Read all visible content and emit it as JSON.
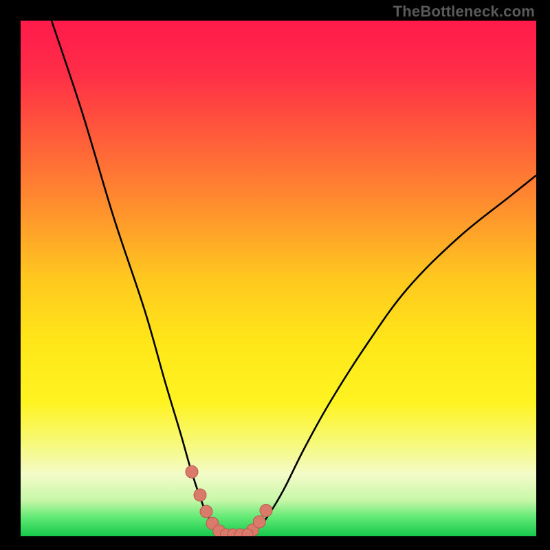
{
  "watermark": {
    "text": "TheBottleneck.com"
  },
  "colors": {
    "gradient_stops": [
      {
        "offset": 0.0,
        "color": "#ff1a4b"
      },
      {
        "offset": 0.1,
        "color": "#ff2d47"
      },
      {
        "offset": 0.22,
        "color": "#ff5a3a"
      },
      {
        "offset": 0.35,
        "color": "#ff8b2f"
      },
      {
        "offset": 0.5,
        "color": "#ffc81f"
      },
      {
        "offset": 0.62,
        "color": "#ffe619"
      },
      {
        "offset": 0.74,
        "color": "#fff321"
      },
      {
        "offset": 0.82,
        "color": "#f6f97a"
      },
      {
        "offset": 0.88,
        "color": "#f3fbc8"
      },
      {
        "offset": 0.93,
        "color": "#c8f7a8"
      },
      {
        "offset": 0.965,
        "color": "#5de872"
      },
      {
        "offset": 1.0,
        "color": "#15c84a"
      }
    ],
    "curve_stroke": "#000000",
    "marker_fill": "#d97a6b",
    "marker_stroke": "#b65a4f"
  },
  "chart_data": {
    "type": "line",
    "title": "",
    "xlabel": "",
    "ylabel": "",
    "xlim": [
      0,
      100
    ],
    "ylim": [
      0,
      100
    ],
    "grid": false,
    "left_curve": {
      "points": [
        [
          6,
          100
        ],
        [
          12,
          82
        ],
        [
          18,
          62
        ],
        [
          24,
          44
        ],
        [
          28,
          30
        ],
        [
          31,
          20
        ],
        [
          33,
          13
        ],
        [
          35,
          7
        ],
        [
          36.5,
          3.5
        ],
        [
          38,
          1.2
        ],
        [
          39.5,
          0.4
        ]
      ]
    },
    "right_curve": {
      "points": [
        [
          44,
          0.4
        ],
        [
          46,
          1.5
        ],
        [
          48,
          4
        ],
        [
          51,
          9
        ],
        [
          55,
          17
        ],
        [
          60,
          26
        ],
        [
          67,
          37
        ],
        [
          75,
          48
        ],
        [
          85,
          58
        ],
        [
          95,
          66
        ],
        [
          100,
          70
        ]
      ]
    },
    "flat_segment": {
      "x_start": 39.5,
      "x_end": 44,
      "y": 0.4
    },
    "markers_left": [
      {
        "x": 33.2,
        "y": 12.5
      },
      {
        "x": 34.8,
        "y": 8.0
      },
      {
        "x": 36.0,
        "y": 4.8
      },
      {
        "x": 37.2,
        "y": 2.5
      },
      {
        "x": 38.5,
        "y": 1.0
      }
    ],
    "markers_right": [
      {
        "x": 45.0,
        "y": 1.2
      },
      {
        "x": 46.3,
        "y": 2.8
      },
      {
        "x": 47.6,
        "y": 5.0
      }
    ],
    "markers_flat": [
      {
        "x": 39.8,
        "y": 0.4
      },
      {
        "x": 41.2,
        "y": 0.4
      },
      {
        "x": 42.6,
        "y": 0.4
      },
      {
        "x": 44.0,
        "y": 0.4
      }
    ]
  }
}
